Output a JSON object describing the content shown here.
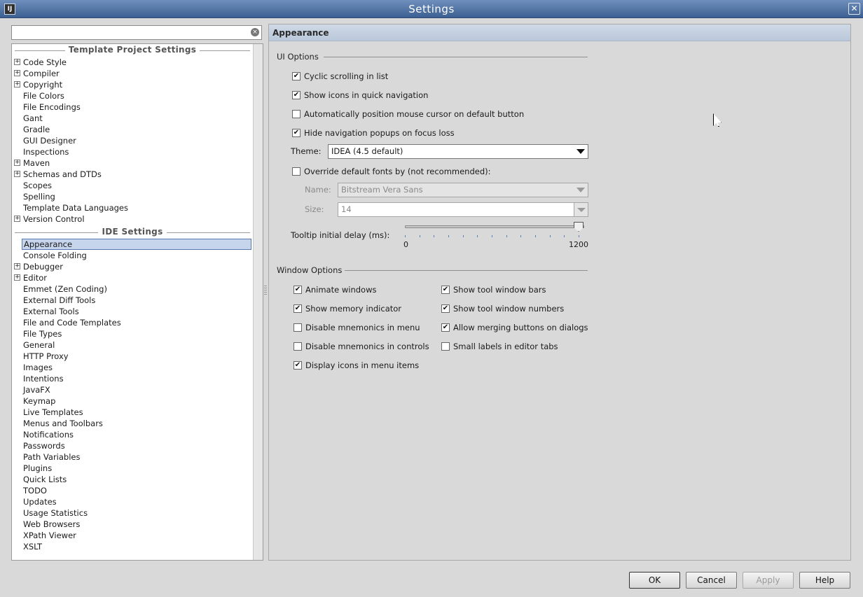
{
  "window": {
    "title": "Settings",
    "app_icon_text": "IJ"
  },
  "search": {
    "value": "",
    "placeholder": ""
  },
  "tree": {
    "template_header": "Template Project Settings",
    "template_items": [
      {
        "label": "Code Style",
        "expandable": true
      },
      {
        "label": "Compiler",
        "expandable": true
      },
      {
        "label": "Copyright",
        "expandable": true
      },
      {
        "label": "File Colors",
        "expandable": false
      },
      {
        "label": "File Encodings",
        "expandable": false
      },
      {
        "label": "Gant",
        "expandable": false
      },
      {
        "label": "Gradle",
        "expandable": false
      },
      {
        "label": "GUI Designer",
        "expandable": false
      },
      {
        "label": "Inspections",
        "expandable": false
      },
      {
        "label": "Maven",
        "expandable": true
      },
      {
        "label": "Schemas and DTDs",
        "expandable": true
      },
      {
        "label": "Scopes",
        "expandable": false
      },
      {
        "label": "Spelling",
        "expandable": false
      },
      {
        "label": "Template Data Languages",
        "expandable": false
      },
      {
        "label": "Version Control",
        "expandable": true
      }
    ],
    "ide_header": "IDE Settings",
    "ide_items": [
      {
        "label": "Appearance",
        "expandable": false,
        "selected": true
      },
      {
        "label": "Console Folding",
        "expandable": false
      },
      {
        "label": "Debugger",
        "expandable": true
      },
      {
        "label": "Editor",
        "expandable": true
      },
      {
        "label": "Emmet (Zen Coding)",
        "expandable": false
      },
      {
        "label": "External Diff Tools",
        "expandable": false
      },
      {
        "label": "External Tools",
        "expandable": false
      },
      {
        "label": "File and Code Templates",
        "expandable": false
      },
      {
        "label": "File Types",
        "expandable": false
      },
      {
        "label": "General",
        "expandable": false
      },
      {
        "label": "HTTP Proxy",
        "expandable": false
      },
      {
        "label": "Images",
        "expandable": false
      },
      {
        "label": "Intentions",
        "expandable": false
      },
      {
        "label": "JavaFX",
        "expandable": false
      },
      {
        "label": "Keymap",
        "expandable": false
      },
      {
        "label": "Live Templates",
        "expandable": false
      },
      {
        "label": "Menus and Toolbars",
        "expandable": false
      },
      {
        "label": "Notifications",
        "expandable": false
      },
      {
        "label": "Passwords",
        "expandable": false
      },
      {
        "label": "Path Variables",
        "expandable": false
      },
      {
        "label": "Plugins",
        "expandable": false
      },
      {
        "label": "Quick Lists",
        "expandable": false
      },
      {
        "label": "TODO",
        "expandable": false
      },
      {
        "label": "Updates",
        "expandable": false
      },
      {
        "label": "Usage Statistics",
        "expandable": false
      },
      {
        "label": "Web Browsers",
        "expandable": false
      },
      {
        "label": "XPath Viewer",
        "expandable": false
      },
      {
        "label": "XSLT",
        "expandable": false
      }
    ]
  },
  "panel": {
    "title": "Appearance",
    "ui_options": {
      "title": "UI Options",
      "cyclic_scrolling": {
        "label": "Cyclic scrolling in list",
        "checked": true
      },
      "show_icons_nav": {
        "label": "Show icons in quick navigation",
        "checked": true
      },
      "auto_position_cursor": {
        "label": "Automatically position mouse cursor on default button",
        "checked": false
      },
      "hide_nav_popups": {
        "label": "Hide navigation popups on focus loss",
        "checked": true
      },
      "theme_label": "Theme:",
      "theme_value": "IDEA (4.5 default)",
      "override_fonts": {
        "label": "Override default fonts by (not recommended):",
        "checked": false
      },
      "font_name_label": "Name:",
      "font_name_value": "Bitstream Vera Sans",
      "font_size_label": "Size:",
      "font_size_value": "14",
      "tooltip_label": "Tooltip initial delay (ms):",
      "tooltip_min": "0",
      "tooltip_max": "1200",
      "tooltip_value_fraction": 1.0
    },
    "window_options": {
      "title": "Window Options",
      "animate_windows": {
        "label": "Animate windows",
        "checked": true
      },
      "show_memory": {
        "label": "Show memory indicator",
        "checked": true
      },
      "disable_mnemonics_menu": {
        "label": "Disable mnemonics in menu",
        "checked": false
      },
      "disable_mnemonics_controls": {
        "label": "Disable mnemonics in controls",
        "checked": false
      },
      "display_icons_menu": {
        "label": "Display icons in menu items",
        "checked": true
      },
      "show_tool_bars": {
        "label": "Show tool window bars",
        "checked": true
      },
      "show_tool_numbers": {
        "label": "Show tool window numbers",
        "checked": true
      },
      "allow_merging": {
        "label": "Allow merging buttons on dialogs",
        "checked": true
      },
      "small_labels": {
        "label": "Small labels in editor tabs",
        "checked": false
      }
    }
  },
  "buttons": {
    "ok": "OK",
    "cancel": "Cancel",
    "apply": "Apply",
    "help": "Help"
  }
}
